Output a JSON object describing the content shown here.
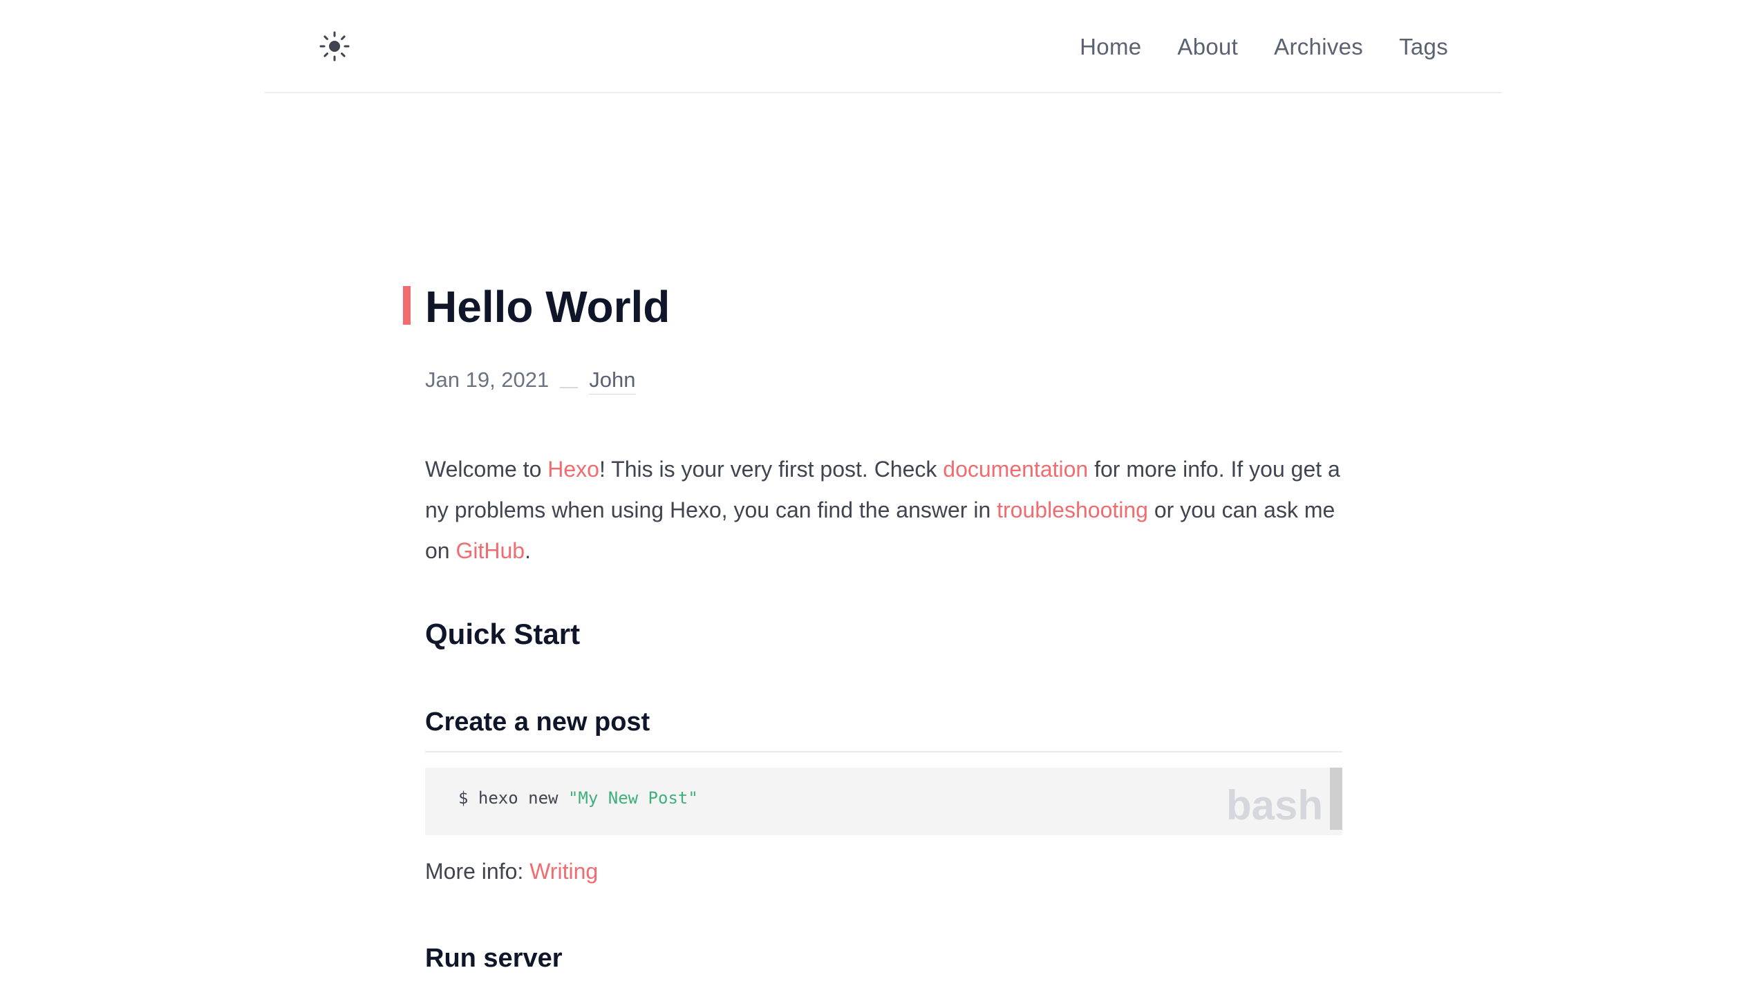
{
  "header": {
    "theme_icon": "sun-icon",
    "nav": [
      "Home",
      "About",
      "Archives",
      "Tags"
    ]
  },
  "post": {
    "title": "Hello World",
    "date": "Jan 19, 2021",
    "author": "John",
    "intro": {
      "t1": "Welcome to ",
      "link_hexo": "Hexo",
      "t2": "! This is your very first post. Check ",
      "link_docs": "documentation",
      "t3": " for more info. If you get any problems when using Hexo, you can find the answer in ",
      "link_troubleshooting": "troubleshooting",
      "t4": " or you can ask me on ",
      "link_github": "GitHub",
      "t5": "."
    },
    "section_quick_start": "Quick Start",
    "section_create_post": "Create a new post",
    "code": {
      "prefix": "$ hexo new ",
      "string": "\"My New Post\"",
      "language": "bash"
    },
    "more_info_label": "More info: ",
    "more_info_link": "Writing",
    "section_run_server": "Run server"
  },
  "colors": {
    "accent": "#f16b6f",
    "heading": "#0f1629",
    "text": "#3f4450",
    "code_string": "#3fb07c"
  }
}
